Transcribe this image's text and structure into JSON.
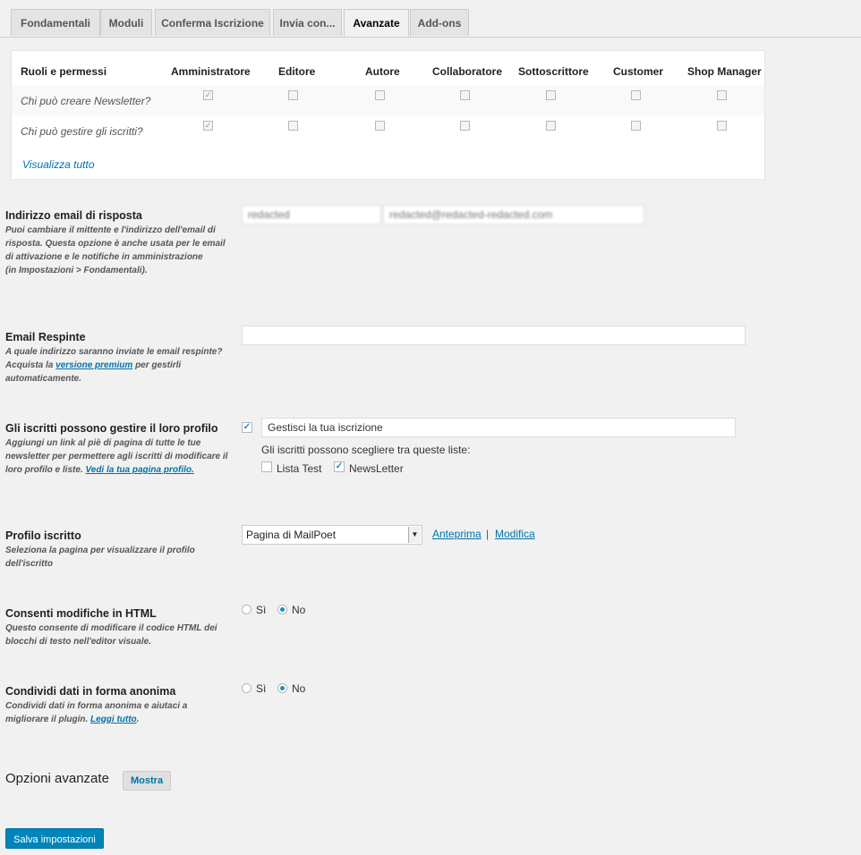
{
  "tabs": [
    "Fondamentali",
    "Moduli",
    "Conferma Iscrizione",
    "Invia con...",
    "Avanzate",
    "Add-ons"
  ],
  "roles_table": {
    "header": "Ruoli e permessi",
    "roles": [
      "Amministratore",
      "Editore",
      "Autore",
      "Collaboratore",
      "Sottoscrittore",
      "Customer",
      "Shop Manager"
    ],
    "rows": [
      {
        "label": "Chi può creare Newsletter?",
        "checked": [
          true,
          false,
          false,
          false,
          false,
          false,
          false
        ]
      },
      {
        "label": "Chi può gestire gli iscritti?",
        "checked": [
          true,
          false,
          false,
          false,
          false,
          false,
          false
        ]
      }
    ],
    "show_all": "Visualizza tutto"
  },
  "reply_email": {
    "title": "Indirizzo email di risposta",
    "description": "Puoi cambiare il mittente e l'indirizzo dell'email di risposta. Questa opzione è anche usata per le email di attivazione e le notifiche in amministrazione",
    "description_note": "(in Impostazioni > Fondamentali).",
    "name_value": "redacted",
    "email_value": "redacted@redacted-redacted.com"
  },
  "bounce_email": {
    "title": "Email Respinte",
    "description_before": "A quale indirizzo saranno inviate le email respinte? Acquista la ",
    "link": "versione premium",
    "description_after": " per gestirli automaticamente.",
    "value": ""
  },
  "manage_profile": {
    "title": "Gli iscritti possono gestire il loro profilo",
    "description": "Aggiungi un link al piè di pagina di tutte le tue newsletter per permettere agli iscritti di modificare il loro profilo e liste. ",
    "link": "Vedi la tua pagina profilo.",
    "enabled": true,
    "link_text_value": "Gestisci la tua iscrizione",
    "lists_label": "Gli iscritti possono scegliere tra queste liste:",
    "lists": [
      {
        "name": "Lista Test",
        "checked": false
      },
      {
        "name": "NewsLetter",
        "checked": true
      }
    ]
  },
  "subscriber_profile": {
    "title": "Profilo iscritto",
    "description": "Seleziona la pagina per visualizzare il profilo dell'iscritto",
    "selected": "Pagina di MailPoet",
    "preview_link": "Anteprima",
    "separator": "|",
    "edit_link": "Modifica"
  },
  "html_edit": {
    "title": "Consenti modifiche in HTML",
    "description": "Questo consente di modificare il codice HTML dei blocchi di testo nell'editor visuale.",
    "options": [
      "Sì",
      "No"
    ],
    "selected": "No"
  },
  "share_data": {
    "title": "Condividi dati in forma anonima",
    "description": "Condividi dati in forma anonima e aiutaci a migliorare il plugin. ",
    "link": "Leggi tutto",
    "options": [
      "Sì",
      "No"
    ],
    "selected": "No"
  },
  "advanced": {
    "title": "Opzioni avanzate",
    "toggle": "Mostra"
  },
  "save_button": "Salva impostazioni"
}
